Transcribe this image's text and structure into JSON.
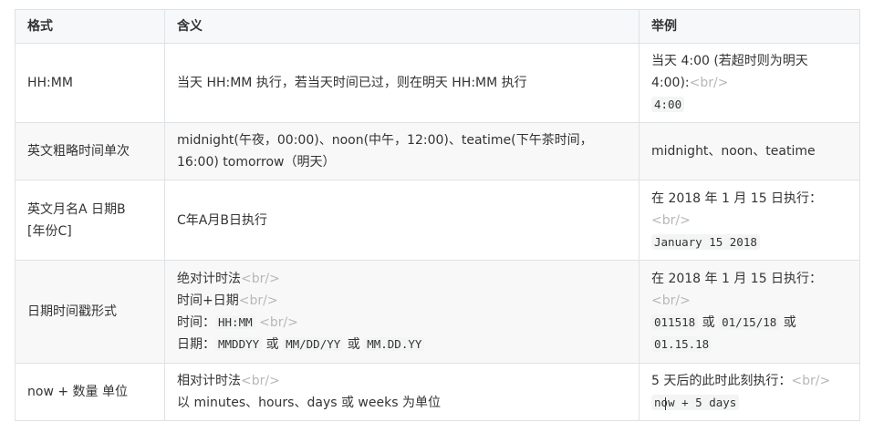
{
  "table": {
    "headers": {
      "format": "格式",
      "meaning": "含义",
      "example": "举例"
    },
    "br_tag": "<br/>",
    "rows": [
      {
        "format": "HH:MM",
        "meaning": "当天 HH:MM 执行，若当天时间已过，则在明天 HH:MM 执行",
        "example_line1": "当天 4:00 (若超时则为明天",
        "example_line2_text": "4:00):",
        "example_code": "4:00"
      },
      {
        "format": "英文粗略时间单次",
        "meaning_line1": "midnight(午夜，00:00)、noon(中午，12:00)、teatime(下午茶时间，",
        "meaning_line2": "16:00)  tomorrow（明天）",
        "example": "midnight、noon、teatime"
      },
      {
        "format_line1": "英文月名A 日期B",
        "format_line2": "[年份C]",
        "meaning": "C年A月B日执行",
        "example_line1": "在 2018 年 1 月 15 日执行：",
        "example_code": "January 15 2018"
      },
      {
        "format": "日期时间戳形式",
        "meaning_line1": "绝对计时法",
        "meaning_line2": "时间+日期",
        "meaning_line3_label": "时间：",
        "meaning_line3_code": "HH:MM",
        "meaning_line4_label": "日期：",
        "meaning_line4_code1": "MMDDYY",
        "meaning_line4_or1": "或",
        "meaning_line4_code2": "MM/DD/YY",
        "meaning_line4_or2": "或",
        "meaning_line4_code3": "MM.DD.YY",
        "example_line1": "在 2018 年 1 月 15 日执行：",
        "example_code1": "011518",
        "example_or1": "或",
        "example_code2": "01/15/18",
        "example_or2": "或",
        "example_code3": "01.15.18"
      },
      {
        "format": "now + 数量 单位",
        "meaning_line1": "相对计时法",
        "meaning_line2": "以 minutes、hours、days 或 weeks 为单位",
        "example_line1": "5 天后的此时此刻执行：",
        "example_code_a": "no",
        "example_code_b": "w + 5 days"
      }
    ]
  }
}
